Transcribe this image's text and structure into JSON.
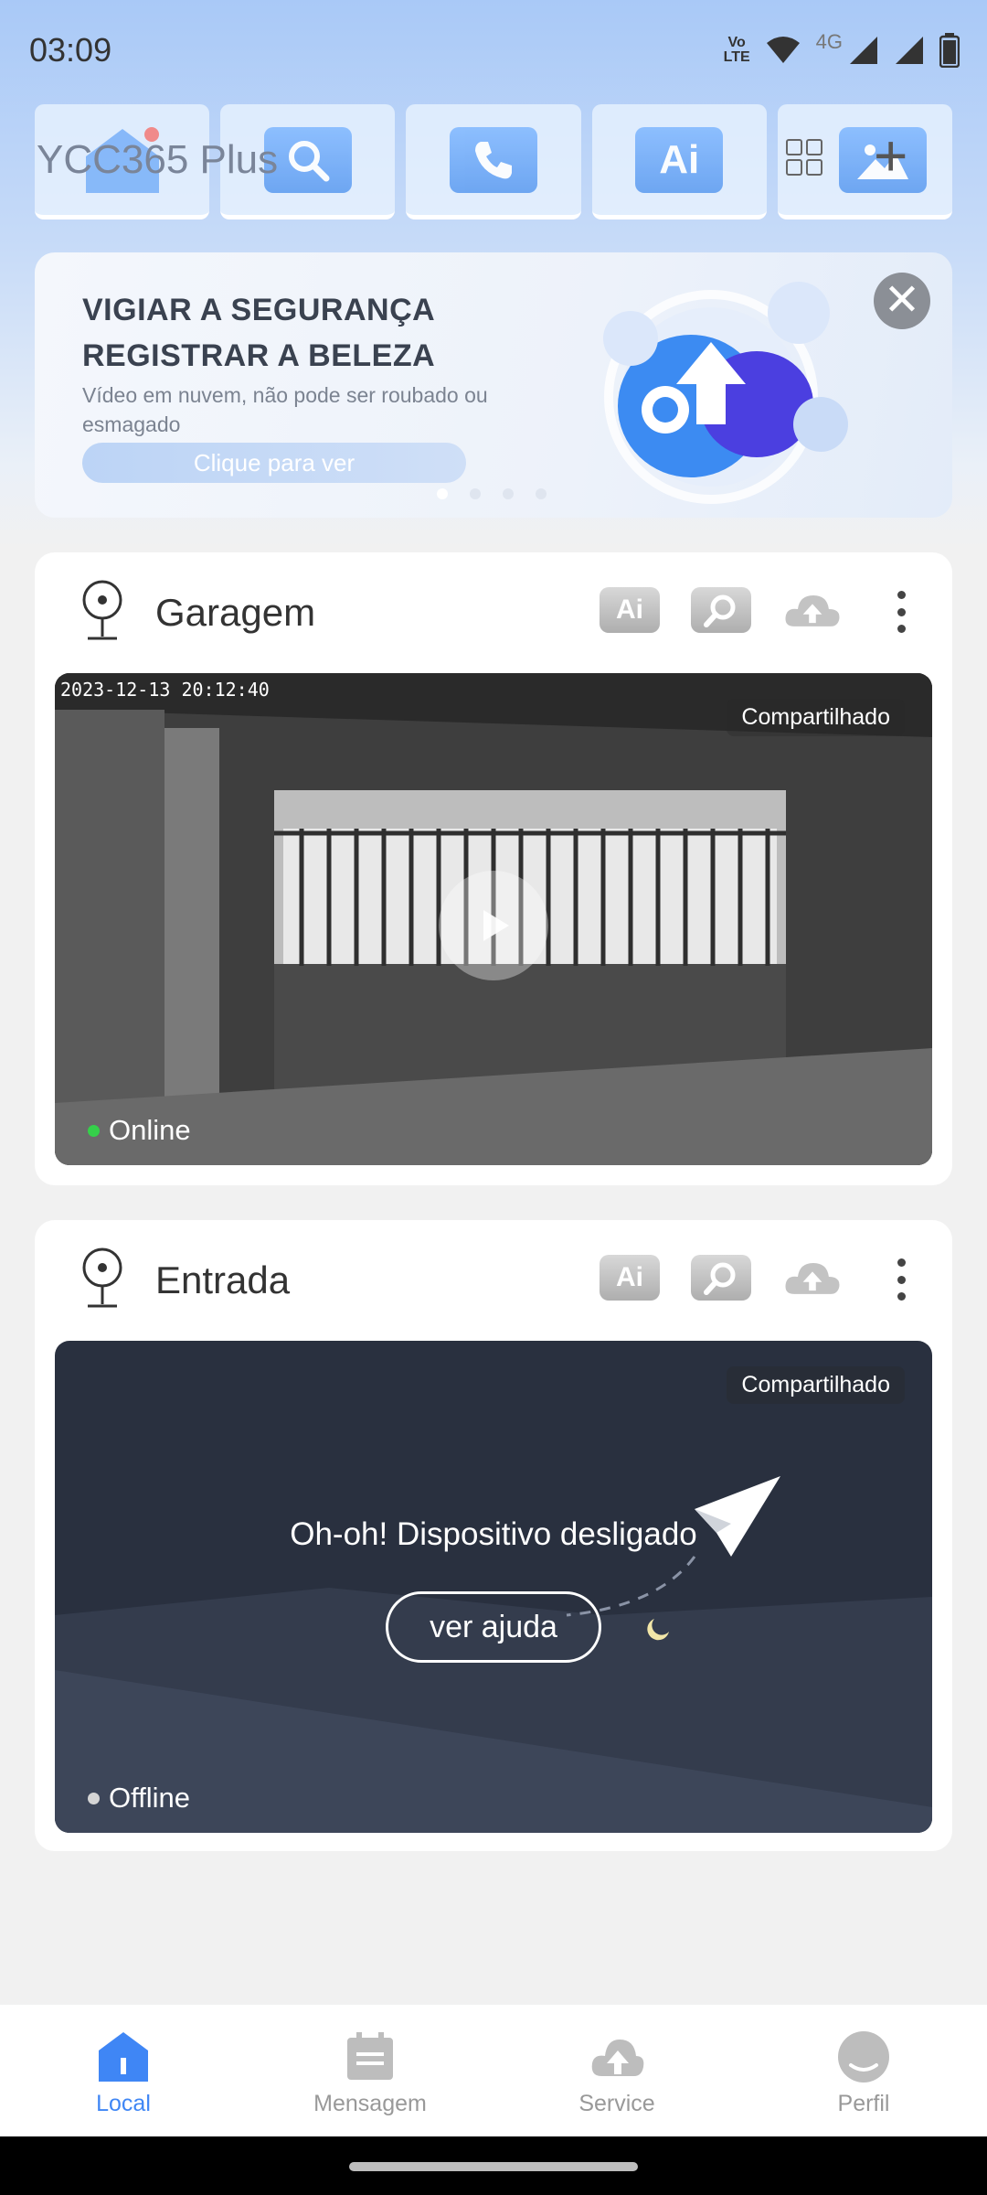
{
  "status_bar": {
    "time": "03:09",
    "volte_top": "Vo",
    "volte_bottom": "LTE",
    "network": "4G",
    "icons": [
      "volte-icon",
      "wifi-icon",
      "signal-icon",
      "signal-icon",
      "battery-icon"
    ]
  },
  "header": {
    "app_title": "YCC365 Plus",
    "quick_actions": [
      {
        "icon": "home-camera-icon",
        "label": ""
      },
      {
        "icon": "search-icon",
        "label": ""
      },
      {
        "icon": "phone-call-icon",
        "label": ""
      },
      {
        "icon": "ai-icon",
        "label": "Ai"
      },
      {
        "icon": "gallery-icon",
        "label": ""
      }
    ],
    "grid_icon": "grid-view-icon",
    "add_icon": "add-icon",
    "add_symbol": "+"
  },
  "banner": {
    "title_line1": "VIGIAR A SEGURANÇA",
    "title_line2": "REGISTRAR A BELEZA",
    "subtitle": "Vídeo em nuvem, não pode ser roubado ou esmagado",
    "button_label": "Clique para ver",
    "close_symbol": "✕",
    "dots": 4,
    "active_dot": 0
  },
  "devices": [
    {
      "name": "Garagem",
      "timestamp": "2023-12-13 20:12:40",
      "shared_label": "Compartilhado",
      "status": "Online",
      "ai_label": "Ai"
    },
    {
      "name": "Entrada",
      "shared_label": "Compartilhado",
      "status": "Offline",
      "offline_message": "Oh-oh! Dispositivo desligado",
      "help_label": "ver ajuda",
      "ai_label": "Ai"
    }
  ],
  "bottom_nav": [
    {
      "label": "Local",
      "icon": "local-home-icon",
      "active": true
    },
    {
      "label": "Mensagem",
      "icon": "message-calendar-icon",
      "active": false
    },
    {
      "label": "Service",
      "icon": "cloud-service-icon",
      "active": false
    },
    {
      "label": "Perfil",
      "icon": "profile-icon",
      "active": false
    }
  ],
  "colors": {
    "accent": "#3f86f5",
    "online": "#35d04a",
    "offline_bg": "#29303f"
  }
}
